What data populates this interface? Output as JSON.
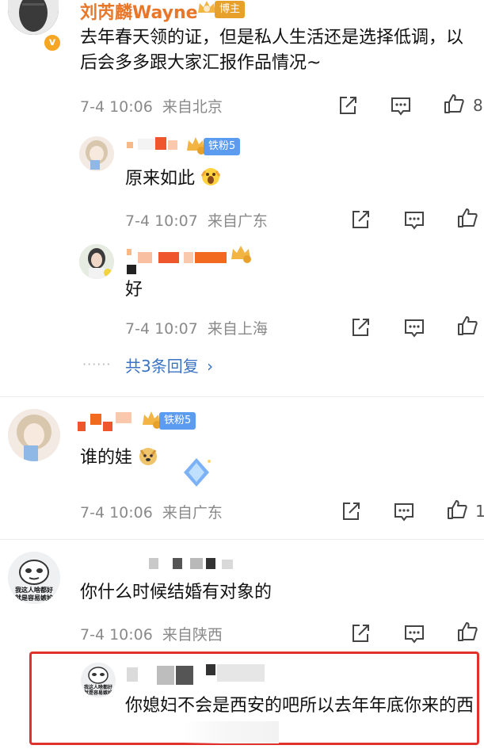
{
  "colors": {
    "name_orange": "#e8772a",
    "link_blue": "#3a73c3",
    "meta_gray": "#8a8a8a",
    "highlight_red": "#e0312c",
    "tag_gold": "#e7a12b",
    "tag_blue": "#5b9bf0"
  },
  "comments": [
    {
      "author": "刘芮麟Wayne",
      "author_tag": "博主",
      "text": "去年春天领的证，但是私人生活还是选择低调，以后会多多跟大家汇报作品情况~",
      "time": "7-4 10:06",
      "location": "来自北京",
      "like_count": "8",
      "verified": true
    },
    {
      "reply": true,
      "fan_tag": "铁粉5",
      "text": "原来如此",
      "emoji": "scream-emoji",
      "time": "7-4 10:07",
      "location": "来自广东"
    },
    {
      "reply": true,
      "text": "好",
      "time": "7-4 10:07",
      "location": "来自上海"
    },
    {
      "fan_tag": "铁粉5",
      "text": "谁的娃",
      "time": "7-4 10:06",
      "location": "来自广东",
      "like_count": "1"
    },
    {
      "text": "你什么时候结婚有对象的",
      "time": "7-4 10:06",
      "location": "来自陕西",
      "avatar_caption": "我这人啥都好 就是容易嫉妒"
    },
    {
      "reply": true,
      "text": "你媳妇不会是西安的吧所以去年年底你来的西",
      "avatar_caption": "我这人啥都好 就是容易嫉妒"
    }
  ],
  "more_replies": "共3条回复",
  "more_dots": "······"
}
